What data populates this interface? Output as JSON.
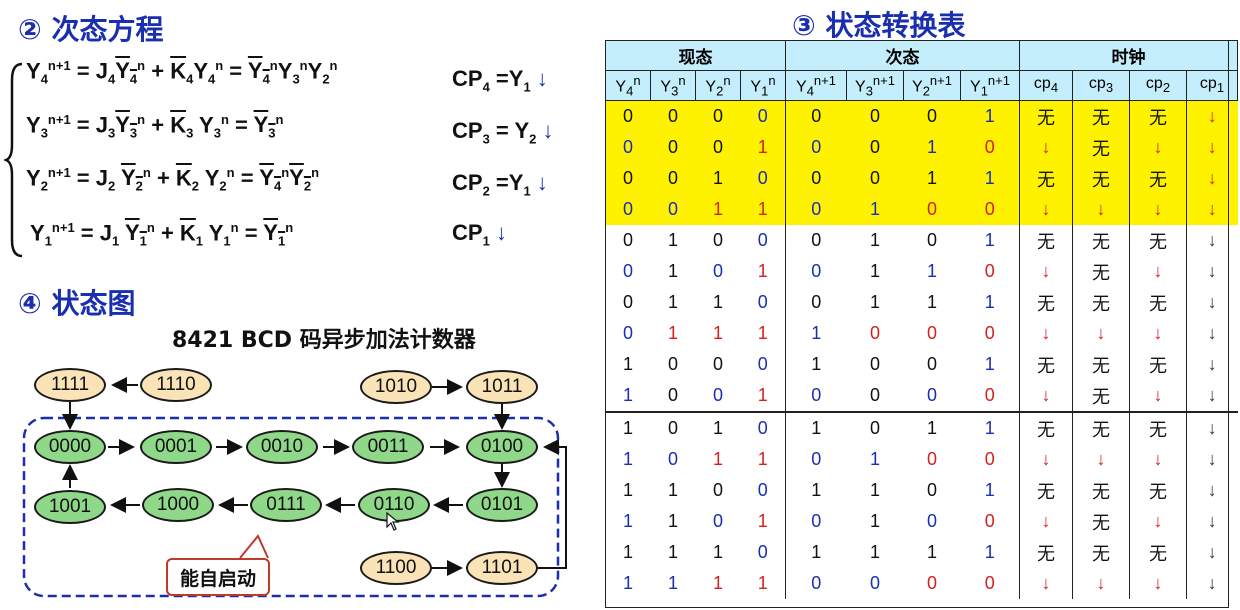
{
  "section2": {
    "title": "② 次态方程"
  },
  "equations": [
    {
      "lhs": "Y4n+1",
      "text_parts": [
        "Y",
        "4",
        "n+1",
        " = J",
        "4",
        "Y",
        "4",
        "n",
        " + ",
        "K",
        "4",
        "Y",
        "4",
        "n",
        " = ",
        "Y",
        "4",
        "n",
        "Y",
        "3",
        "n",
        "Y",
        "2",
        "n"
      ]
    }
  ],
  "eq_labels": {
    "y4": "Y4n+1 = J4 Y4n + K4Y4n = Y4nY3nY2n",
    "y3": "Y3n+1 = J3 Y3n + K3 Y3n = Y3n",
    "y2": "Y2n+1 = J2 Y2n + K2 Y2n = Y4nY2n",
    "y1": "Y1n+1 = J1 Y1n + K1 Y1n = Y1n"
  },
  "clocks": {
    "cp4": "CP4 =Y1 ↓",
    "cp3": "CP3 = Y2 ↓",
    "cp2": "CP2 =Y1 ↓",
    "cp1": "CP1 ↓"
  },
  "section4": {
    "title": "④ 状态图",
    "subtitle": "8421 BCD 码异步加法计数器"
  },
  "diagram": {
    "main_cycle": [
      "0000",
      "0001",
      "0010",
      "0011",
      "0100",
      "0101",
      "0110",
      "0111",
      "1000",
      "1001"
    ],
    "extra": [
      "1111",
      "1110",
      "1010",
      "1011",
      "1100",
      "1101"
    ],
    "callout": "能自启动"
  },
  "section3": {
    "title": "③ 状态转换表"
  },
  "table": {
    "group_headers": [
      "现态",
      "次态",
      "时钟"
    ],
    "col_headers": [
      "Y4n",
      "Y3n",
      "Y2n",
      "Y1n",
      "Y4n+1",
      "Y3n+1",
      "Y2n+1",
      "Y1n+1",
      "cp4",
      "cp3",
      "cp2",
      "cp1"
    ],
    "rows": [
      [
        "0",
        "0",
        "0",
        "0",
        "0",
        "0",
        "0",
        "1",
        "无",
        "无",
        "无",
        "↓"
      ],
      [
        "0",
        "0",
        "0",
        "1",
        "0",
        "0",
        "1",
        "0",
        "↓",
        "无",
        "↓",
        "↓"
      ],
      [
        "0",
        "0",
        "1",
        "0",
        "0",
        "0",
        "1",
        "1",
        "无",
        "无",
        "无",
        "↓"
      ],
      [
        "0",
        "0",
        "1",
        "1",
        "0",
        "1",
        "0",
        "0",
        "↓",
        "↓",
        "↓",
        "↓"
      ],
      [
        "0",
        "1",
        "0",
        "0",
        "0",
        "1",
        "0",
        "1",
        "无",
        "无",
        "无",
        "↓"
      ],
      [
        "0",
        "1",
        "0",
        "1",
        "0",
        "1",
        "1",
        "0",
        "↓",
        "无",
        "↓",
        "↓"
      ],
      [
        "0",
        "1",
        "1",
        "0",
        "0",
        "1",
        "1",
        "1",
        "无",
        "无",
        "无",
        "↓"
      ],
      [
        "0",
        "1",
        "1",
        "1",
        "1",
        "0",
        "0",
        "0",
        "↓",
        "↓",
        "↓",
        "↓"
      ],
      [
        "1",
        "0",
        "0",
        "0",
        "1",
        "0",
        "0",
        "1",
        "无",
        "无",
        "无",
        "↓"
      ],
      [
        "1",
        "0",
        "0",
        "1",
        "0",
        "0",
        "0",
        "0",
        "↓",
        "无",
        "↓",
        "↓"
      ],
      [
        "1",
        "0",
        "1",
        "0",
        "1",
        "0",
        "1",
        "1",
        "无",
        "无",
        "无",
        "↓"
      ],
      [
        "1",
        "0",
        "1",
        "1",
        "0",
        "1",
        "0",
        "0",
        "↓",
        "↓",
        "↓",
        "↓"
      ],
      [
        "1",
        "1",
        "0",
        "0",
        "1",
        "1",
        "0",
        "1",
        "无",
        "无",
        "无",
        "↓"
      ],
      [
        "1",
        "1",
        "0",
        "1",
        "0",
        "1",
        "0",
        "0",
        "↓",
        "无",
        "↓",
        "↓"
      ],
      [
        "1",
        "1",
        "1",
        "0",
        "1",
        "1",
        "1",
        "1",
        "无",
        "无",
        "无",
        "↓"
      ],
      [
        "1",
        "1",
        "1",
        "1",
        "0",
        "0",
        "0",
        "0",
        "↓",
        "↓",
        "↓",
        "↓"
      ]
    ],
    "colors": [
      [
        "k",
        "k",
        "k",
        "b",
        "k",
        "k",
        "k",
        "b",
        "k",
        "k",
        "k",
        "ra"
      ],
      [
        "b",
        "k",
        "k",
        "r",
        "b",
        "k",
        "b",
        "r",
        "ra",
        "k",
        "ra",
        "ra"
      ],
      [
        "k",
        "k",
        "k",
        "b",
        "k",
        "k",
        "k",
        "b",
        "k",
        "k",
        "k",
        "ra"
      ],
      [
        "b",
        "b",
        "r",
        "r",
        "b",
        "b",
        "r",
        "r",
        "ra",
        "ra",
        "ra",
        "ra"
      ],
      [
        "k",
        "k",
        "k",
        "b",
        "k",
        "k",
        "k",
        "b",
        "k",
        "k",
        "k",
        "ka"
      ],
      [
        "b",
        "k",
        "b",
        "r",
        "b",
        "k",
        "b",
        "r",
        "ra",
        "k",
        "ra",
        "ka"
      ],
      [
        "k",
        "k",
        "k",
        "b",
        "k",
        "k",
        "k",
        "b",
        "k",
        "k",
        "k",
        "ka"
      ],
      [
        "b",
        "r",
        "r",
        "r",
        "b",
        "r",
        "r",
        "r",
        "ra",
        "ra",
        "ra",
        "ka"
      ],
      [
        "k",
        "k",
        "k",
        "b",
        "k",
        "k",
        "k",
        "b",
        "k",
        "k",
        "k",
        "ka"
      ],
      [
        "b",
        "k",
        "b",
        "r",
        "b",
        "k",
        "b",
        "r",
        "ra",
        "k",
        "ra",
        "ka"
      ],
      [
        "k",
        "k",
        "k",
        "b",
        "k",
        "k",
        "k",
        "b",
        "k",
        "k",
        "k",
        "ka"
      ],
      [
        "b",
        "b",
        "r",
        "r",
        "b",
        "b",
        "r",
        "r",
        "ra",
        "ra",
        "ra",
        "ka"
      ],
      [
        "k",
        "k",
        "k",
        "b",
        "k",
        "k",
        "k",
        "b",
        "k",
        "k",
        "k",
        "ka"
      ],
      [
        "b",
        "k",
        "b",
        "r",
        "b",
        "k",
        "b",
        "r",
        "ra",
        "k",
        "ra",
        "ka"
      ],
      [
        "k",
        "k",
        "k",
        "b",
        "k",
        "k",
        "k",
        "b",
        "k",
        "k",
        "k",
        "ka"
      ],
      [
        "b",
        "b",
        "r",
        "r",
        "b",
        "b",
        "r",
        "r",
        "ra",
        "ra",
        "ra",
        "ka"
      ]
    ],
    "highlight_rows": 4
  },
  "colors": {
    "accent": "#1a2fb0",
    "red": "#d32020",
    "highlight": "#fff200",
    "header_bg": "#c5eefc",
    "node_green": "#8fd88a",
    "node_tan": "#fbe3b8"
  }
}
